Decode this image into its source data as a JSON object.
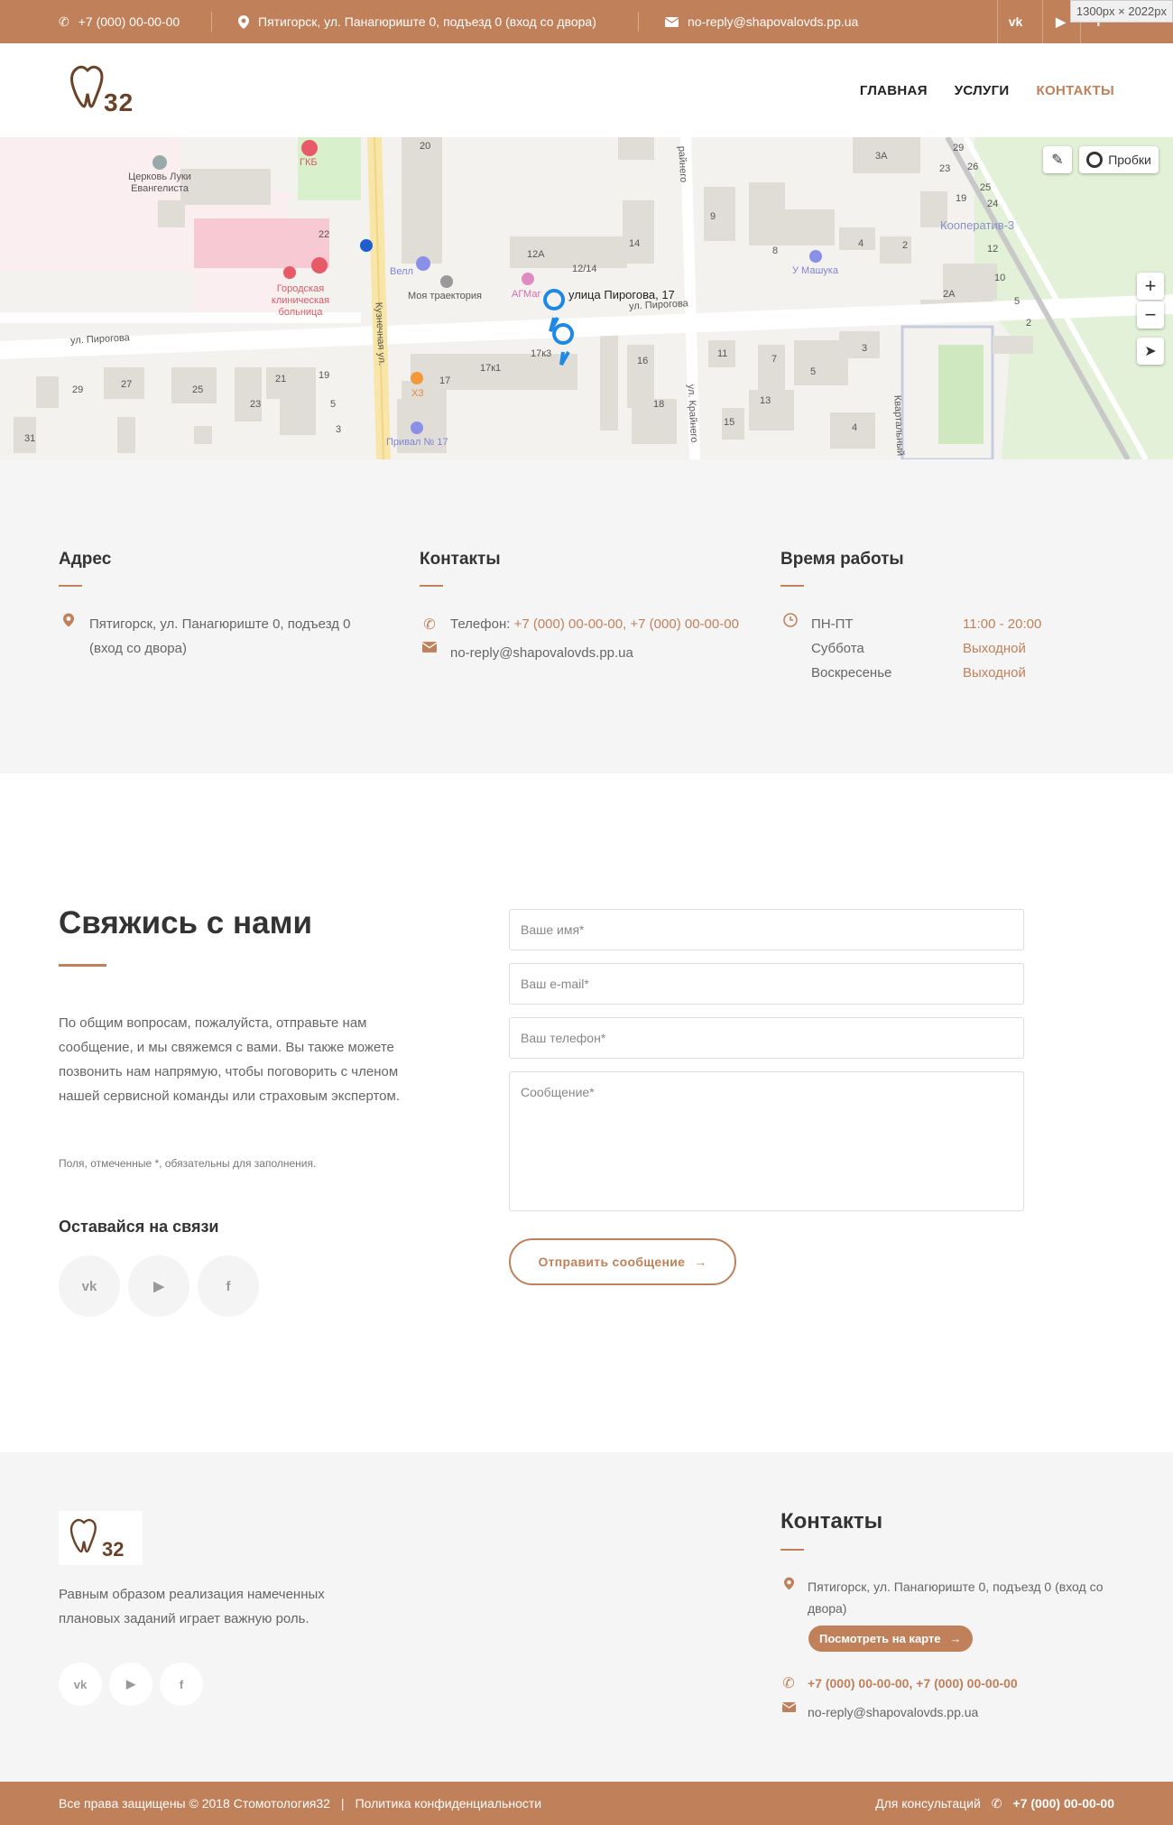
{
  "topbar": {
    "phone": "+7 (000) 00-00-00",
    "address": "Пятигорск, ул. Панагюриште 0, подъезд 0 (вход со двора)",
    "email": "no-reply@shapovalovds.pp.ua",
    "social": [
      "vk",
      "youtube",
      "facebook"
    ],
    "size_badge": "1300px × 2022px"
  },
  "header": {
    "logo_text": "32",
    "nav": [
      "ГЛАВНАЯ",
      "УСЛУГИ",
      "КОНТАКТЫ"
    ]
  },
  "map": {
    "traffic_label": "Пробки",
    "marker_label": "улица Пирогова, 17",
    "streets": [
      "ул. Пирогова",
      "ул. Пирогова",
      "Кузнечная ул.",
      "ул. Крайнего",
      "Квартальный п",
      "райнего"
    ],
    "places": [
      "Церковь Луки Евангелиста",
      "ГКБ",
      "Городская клиническая больница",
      "Велл",
      "Моя траектория",
      "АГМаг",
      "У Машука",
      "Кооператив-3",
      "Х3",
      "Привал № 17"
    ],
    "house_numbers": [
      "20",
      "22",
      "12А",
      "12/14",
      "14",
      "9",
      "8",
      "4",
      "2",
      "3А",
      "29",
      "26",
      "23",
      "25",
      "19",
      "24",
      "12",
      "10",
      "5",
      "2",
      "2А",
      "17к3",
      "17к1",
      "17",
      "16",
      "18",
      "11",
      "7",
      "5",
      "3",
      "13",
      "15",
      "4",
      "29",
      "27",
      "25",
      "21",
      "19",
      "23",
      "5",
      "3",
      "31"
    ]
  },
  "info": {
    "address": {
      "title": "Адрес",
      "text": "Пятигорск, ул. Панагюриште 0, подъезд 0 (вход со двора)"
    },
    "contacts": {
      "title": "Контакты",
      "phone_label": "Телефон:",
      "phones": "+7 (000) 00-00-00, +7 (000) 00-00-00",
      "email": "no-reply@shapovalovds.pp.ua"
    },
    "hours": {
      "title": "Время работы",
      "rows": [
        {
          "day": "ПН-ПТ",
          "time": "11:00 - 20:00"
        },
        {
          "day": "Суббота",
          "time": "Выходной"
        },
        {
          "day": "Воскресенье",
          "time": "Выходной"
        }
      ]
    }
  },
  "contact_form": {
    "title": "Свяжись с нами",
    "description": "По общим вопросам, пожалуйста, отправьте нам сообщение, и мы свяжемся с вами. Вы также можете позвонить нам напрямую, чтобы поговорить с членом нашей сервисной команды или страховым экспертом.",
    "required_note": "Поля, отмеченные *, обязательны для заполнения.",
    "stay_title": "Оставайся на связи",
    "name_placeholder": "Ваше имя*",
    "email_placeholder": "Ваш e-mail*",
    "phone_placeholder": "Ваш телефон*",
    "message_placeholder": "Сообщение*",
    "submit_label": "Отправить сообщение"
  },
  "footer": {
    "logo_text": "32",
    "description": "Равным образом реализация намеченных плановых заданий играет важную роль.",
    "contacts_title": "Контакты",
    "address": "Пятигорск, ул. Панагюриште 0, подъезд 0 (вход со двора)",
    "map_button": "Посмотреть на карте",
    "phones": "+7 (000) 00-00-00, +7 (000) 00-00-00",
    "email": "no-reply@shapovalovds.pp.ua"
  },
  "bottombar": {
    "copyright": "Все права защищены © 2018 Стомотология32",
    "divider": "|",
    "privacy": "Политика конфиденциальности",
    "consult_label": "Для консультаций",
    "phone": "+7 (000) 00-00-00"
  },
  "colors": {
    "accent": "#c0805a",
    "light_bg": "#f5f5f6",
    "text": "#555555"
  }
}
